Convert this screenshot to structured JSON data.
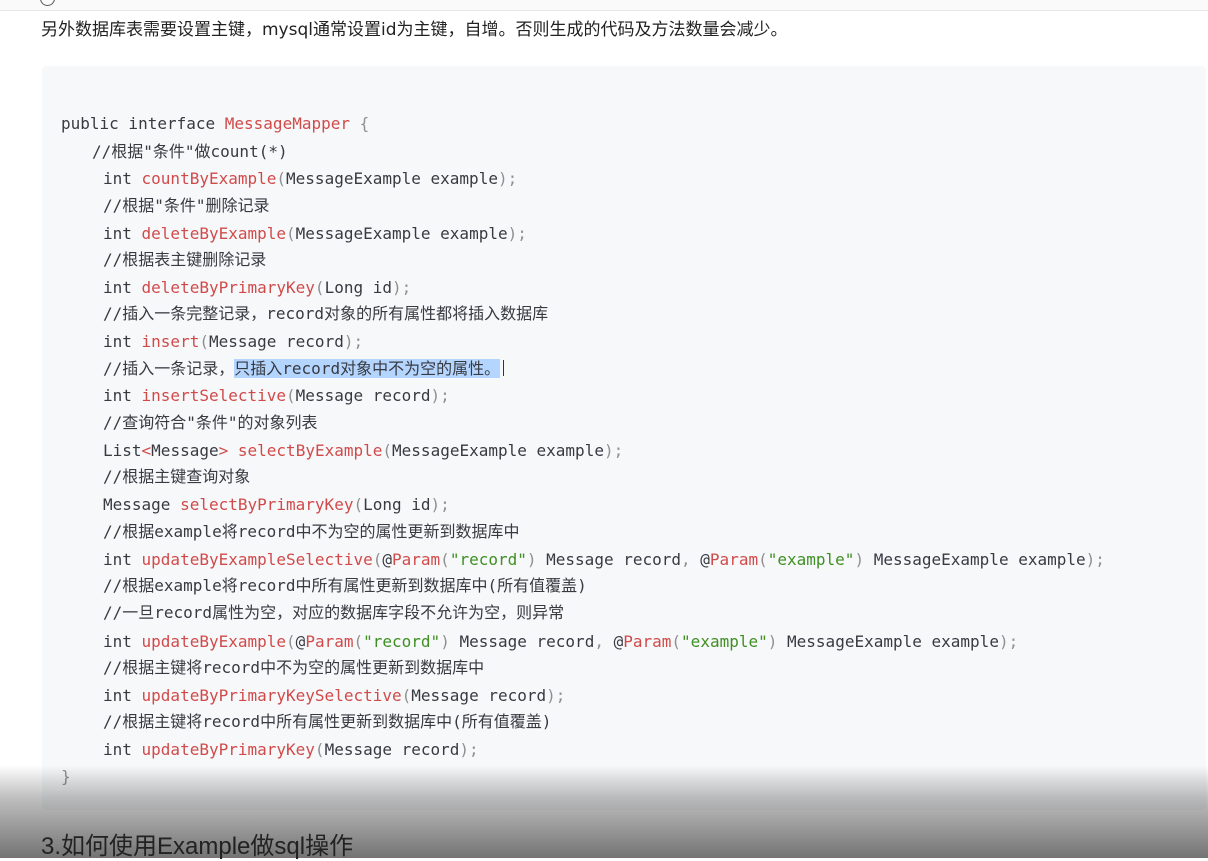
{
  "page": {
    "intro": "另外数据库表需要设置主键，mysql通常设置id为主键，自增。否则生成的代码及方法数量会减少。",
    "section_heading": "3.如何使用Example做sql操作"
  },
  "code": {
    "l01_kw": "public interface ",
    "l01_name": "MessageMapper",
    "l01_brace": " {",
    "l02": "//根据\"条件\"做count(*)",
    "l03_ret": "int ",
    "l03_fn": "countByExample",
    "l03_args": "MessageExample example",
    "l04": "//根据\"条件\"删除记录",
    "l05_ret": "int ",
    "l05_fn": "deleteByExample",
    "l05_args": "MessageExample example",
    "l06": "//根据表主键删除记录",
    "l07_ret": "int ",
    "l07_fn": "deleteByPrimaryKey",
    "l07_args": "Long id",
    "l08": "//插入一条完整记录，record对象的所有属性都将插入数据库",
    "l09_ret": "int ",
    "l09_fn": "insert",
    "l09_args": "Message record",
    "l10_pre": "//插入一条记录，",
    "l10_sel": "只插入record对象中不为空的属性。",
    "l11_ret": "int ",
    "l11_fn": "insertSelective",
    "l11_args": "Message record",
    "l12": "//查询符合\"条件\"的对象列表",
    "l13_ret_a": "List",
    "l13_lt": "<",
    "l13_ret_b": "Message",
    "l13_gt": ">",
    "l13_sp": " ",
    "l13_fn": "selectByExample",
    "l13_args": "MessageExample example",
    "l14": "//根据主键查询对象",
    "l15_ret": "Message ",
    "l15_fn": "selectByPrimaryKey",
    "l15_args": "Long id",
    "l16": "//根据example将record中不为空的属性更新到数据库中",
    "l17_ret": "int ",
    "l17_fn": "updateByExampleSelective",
    "l17_at1": "@",
    "l17_ann1": "Param",
    "l17_str1": "\"record\"",
    "l17_mid": " Message record",
    "l17_comma": ", ",
    "l17_at2": "@",
    "l17_ann2": "Param",
    "l17_str2": "\"example\"",
    "l17_end": " MessageExample example",
    "l18": "//根据example将record中所有属性更新到数据库中(所有值覆盖)",
    "l19": "//一旦record属性为空，对应的数据库字段不允许为空，则异常",
    "l20_ret": "int ",
    "l20_fn": "updateByExample",
    "l20_at1": "@",
    "l20_ann1": "Param",
    "l20_str1": "\"record\"",
    "l20_mid": " Message record",
    "l20_comma": ", ",
    "l20_at2": "@",
    "l20_ann2": "Param",
    "l20_str2": "\"example\"",
    "l20_end": " MessageExample example",
    "l21": "//根据主键将record中不为空的属性更新到数据库中",
    "l22_ret": "int ",
    "l22_fn": "updateByPrimaryKeySelective",
    "l22_args": "Message record",
    "l23": "//根据主键将record中所有属性更新到数据库中(所有值覆盖)",
    "l24_ret": "int ",
    "l24_fn": "updateByPrimaryKey",
    "l24_args": "Message record",
    "l25": "}",
    "open_paren": "(",
    "close_paren_semi": ");",
    "close_paren": ")"
  }
}
